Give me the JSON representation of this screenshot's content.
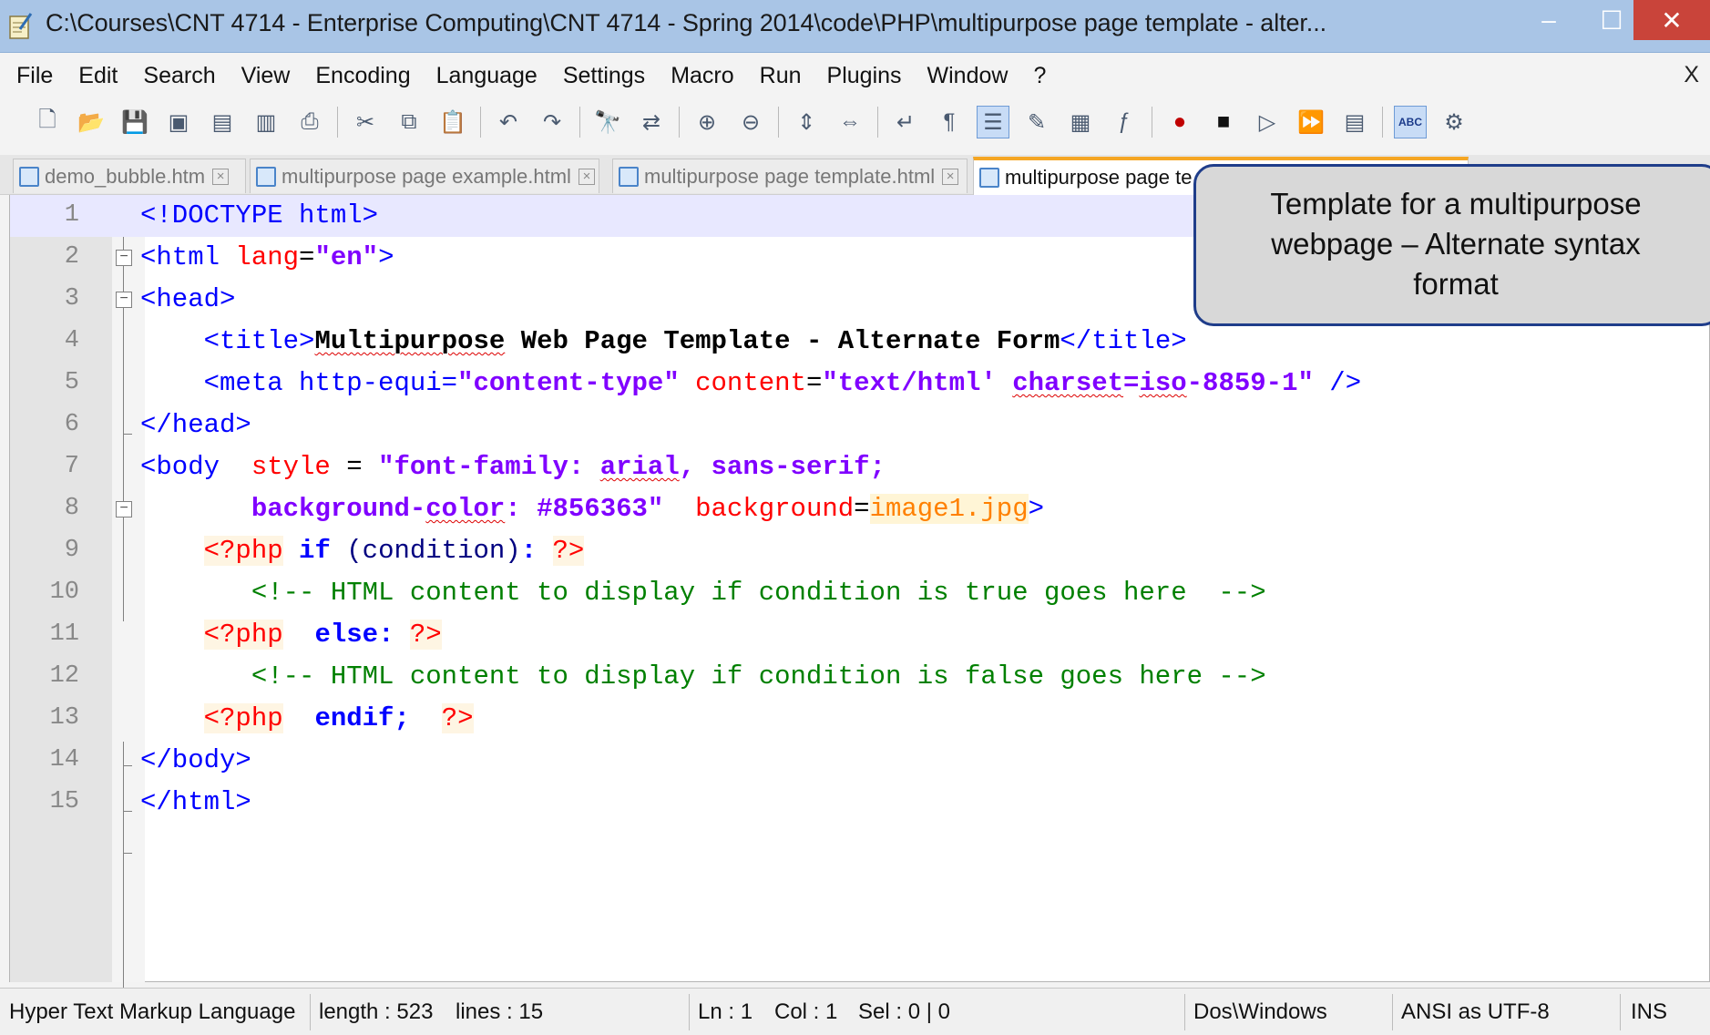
{
  "window": {
    "title": "C:\\Courses\\CNT 4714 - Enterprise Computing\\CNT 4714 - Spring 2014\\code\\PHP\\multipurpose page template - alter...",
    "min_glyph": "–",
    "max_glyph": "☐",
    "close_glyph": "✕"
  },
  "menu": {
    "items": [
      "File",
      "Edit",
      "Search",
      "View",
      "Encoding",
      "Language",
      "Settings",
      "Macro",
      "Run",
      "Plugins",
      "Window",
      "?"
    ],
    "close": "X"
  },
  "toolbar": {
    "icons": [
      "new-file-icon",
      "open-file-icon",
      "save-icon",
      "save-all-icon",
      "close-icon",
      "close-all-icon",
      "print-icon",
      "cut-icon",
      "copy-icon",
      "paste-icon",
      "undo-icon",
      "redo-icon",
      "find-icon",
      "replace-icon",
      "zoom-in-icon",
      "zoom-out-icon",
      "sync-vertical-icon",
      "sync-horizontal-icon",
      "word-wrap-icon",
      "show-all-chars-icon",
      "indent-guide-icon",
      "user-language-icon",
      "doc-map-icon",
      "function-list-icon",
      "record-macro-icon",
      "stop-macro-icon",
      "play-macro-icon",
      "run-macro-multiple-icon",
      "save-macro-icon",
      "spell-check-icon",
      "spell-settings-icon"
    ]
  },
  "tabs": [
    {
      "label": "demo_bubble.htm",
      "active": false
    },
    {
      "label": "multipurpose page example.html",
      "active": false
    },
    {
      "label": "multipurpose page template.html",
      "active": false
    },
    {
      "label": "multipurpose page te",
      "active": true
    }
  ],
  "callout": {
    "line1": "Template for a multipurpose",
    "line2": "webpage – Alternate syntax",
    "line3": "format"
  },
  "code": {
    "line_numbers": [
      "1",
      "2",
      "3",
      "4",
      "5",
      "6",
      "7",
      "8",
      "9",
      "10",
      "11",
      "12",
      "13",
      "14",
      "15"
    ],
    "l1": {
      "a": "<!DOCTYPE html>"
    },
    "l2": {
      "a": "<html ",
      "b": "lang",
      "c": "=",
      "d": "\"en\"",
      "e": ">"
    },
    "l3": {
      "a": "<head>"
    },
    "l4": {
      "pre": "    ",
      "a": "<title>",
      "b": "Multipurpose",
      "c": " Web Page Template - Alternate Form",
      "d": "</title>"
    },
    "l5": {
      "pre": "    ",
      "a": "<meta http-equi=",
      "b": "\"content-type\"",
      "c": " content",
      "d": "=",
      "e": "\"text/html' ",
      "f": "charset",
      "g": "=",
      "h": "iso",
      "i": "-8859-1\"",
      "j": " />"
    },
    "l6": {
      "a": "</head>"
    },
    "l7": {
      "a": "<body ",
      "b": " style",
      "c": " = ",
      "d": "\"font-family: ",
      "e": "arial",
      "f": ", sans-serif;"
    },
    "l8": {
      "pre": "       ",
      "a": "background-",
      "b": "color",
      "c": ": #856363\"",
      "d": "  background",
      "e": "=",
      "f": "image1.jpg",
      "g": ">"
    },
    "l9": {
      "pre": "    ",
      "a": "<?php",
      "b": " if ",
      "c": "(condition)",
      "d": ": ",
      "e": "?>"
    },
    "l10": {
      "pre": "       ",
      "a": "<!-- HTML content to display if condition is true goes here  -->"
    },
    "l11": {
      "pre": "    ",
      "a": "<?php",
      "b": "  else",
      "c": ": ",
      "d": "?>"
    },
    "l12": {
      "pre": "       ",
      "a": "<!-- HTML content to display if condition is false goes here -->"
    },
    "l13": {
      "pre": "    ",
      "a": "<?php",
      "b": "  endif",
      "c": ";  ",
      "d": "?>"
    },
    "l14": {
      "a": "</body>"
    },
    "l15": {
      "a": "</html>"
    }
  },
  "status": {
    "language": "Hyper Text Markup Language",
    "length": "length : 523",
    "lines": "lines : 15",
    "ln": "Ln : 1",
    "col": "Col : 1",
    "sel": "Sel : 0 | 0",
    "eol": "Dos\\Windows",
    "encoding": "ANSI as UTF-8",
    "mode": "INS"
  }
}
